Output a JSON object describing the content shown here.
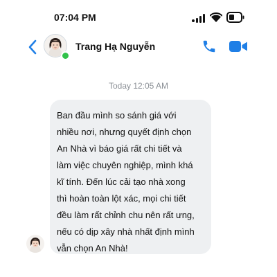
{
  "status_bar": {
    "time": "07:04 PM",
    "icons": [
      "signal-icon",
      "wifi-icon",
      "battery-icon"
    ]
  },
  "header": {
    "contact_name": "Trang Hạ Nguyễn",
    "online": true,
    "icons": [
      "back-chevron-icon",
      "phone-icon",
      "video-camera-icon"
    ]
  },
  "conversation": {
    "timestamp": "Today 12:05 AM",
    "message": {
      "lines": [
        "Ban đầu mình so sánh giá với",
        "nhiều nơi, nhưng quyết định chọn",
        "An Nhà vì báo giá rất chi tiết và",
        "làm việc chuyên nghiệp, mình khá",
        "kĩ tính. Đến lúc cải tạo nhà xong",
        "thì hoàn toàn lột xác, mọi chi tiết",
        "đều làm rất chỉnh chu nên rất ưng,",
        "nếu có dịp xây nhà nhất định mình",
        "vẫn chọn An Nhà!"
      ]
    }
  },
  "colors": {
    "accent": "#1f7fe6",
    "bubble": "#eef0f2",
    "online": "#31c24a",
    "timestamp": "#8b9096"
  }
}
